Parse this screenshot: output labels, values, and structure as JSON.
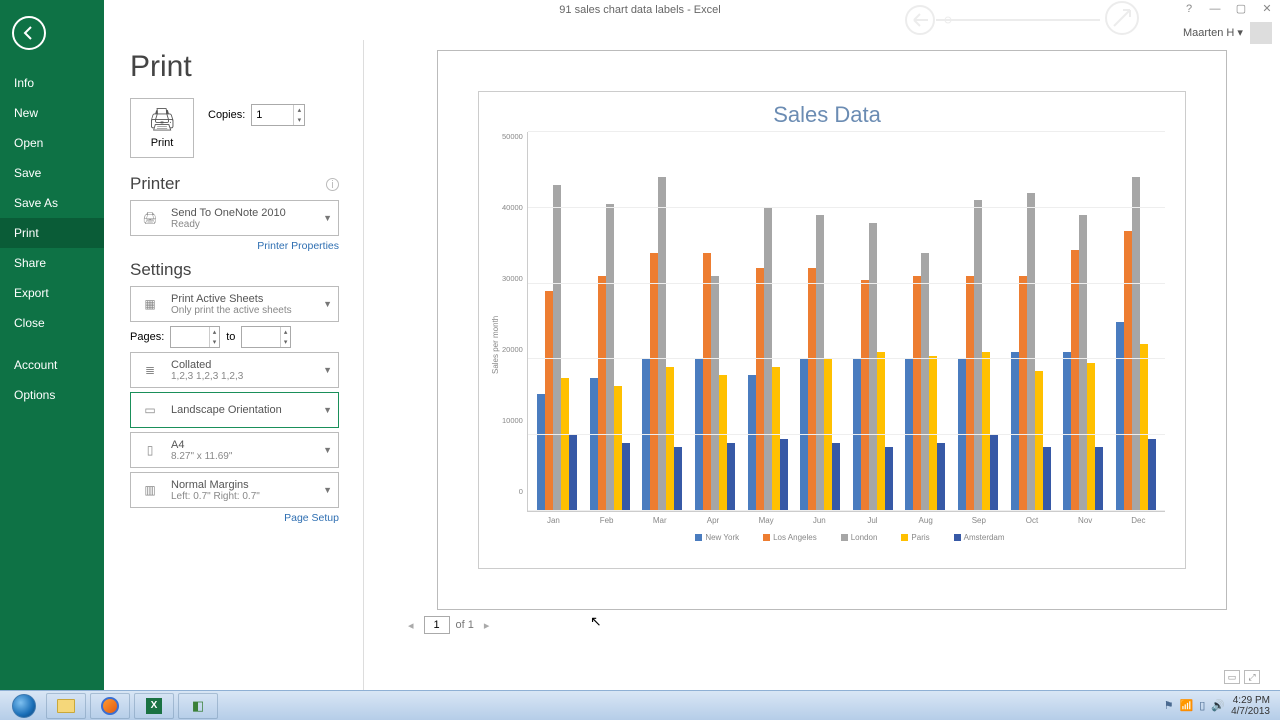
{
  "window": {
    "title": "91 sales chart data labels - Excel",
    "user": "Maarten H"
  },
  "sidebar": {
    "items": [
      {
        "label": "Info"
      },
      {
        "label": "New"
      },
      {
        "label": "Open"
      },
      {
        "label": "Save"
      },
      {
        "label": "Save As"
      },
      {
        "label": "Print",
        "active": true
      },
      {
        "label": "Share"
      },
      {
        "label": "Export"
      },
      {
        "label": "Close"
      }
    ],
    "secondary": [
      {
        "label": "Account"
      },
      {
        "label": "Options"
      }
    ]
  },
  "page": {
    "title": "Print",
    "print_button": "Print",
    "copies_label": "Copies:",
    "copies_value": "1"
  },
  "printer": {
    "heading": "Printer",
    "name": "Send To OneNote 2010",
    "status": "Ready",
    "properties_link": "Printer Properties"
  },
  "settings": {
    "heading": "Settings",
    "active_sheets": {
      "line1": "Print Active Sheets",
      "line2": "Only print the active sheets"
    },
    "pages_label": "Pages:",
    "pages_to": "to",
    "collated": {
      "line1": "Collated",
      "line2": "1,2,3    1,2,3    1,2,3"
    },
    "orientation": {
      "line1": "Landscape Orientation"
    },
    "paper": {
      "line1": "A4",
      "line2": "8.27\" x 11.69\""
    },
    "margins": {
      "line1": "Normal Margins",
      "line2": "Left:  0.7\"     Right:  0.7\""
    },
    "page_setup_link": "Page Setup"
  },
  "nav": {
    "page": "1",
    "of": "of 1"
  },
  "taskbar": {
    "time": "4:29 PM",
    "date": "4/7/2013"
  },
  "chart_data": {
    "type": "bar",
    "title": "Sales Data",
    "ylabel": "Sales per month",
    "ylim": [
      0,
      50000
    ],
    "yticks": [
      0,
      10000,
      20000,
      30000,
      40000,
      50000
    ],
    "categories": [
      "Jan",
      "Feb",
      "Mar",
      "Apr",
      "May",
      "Jun",
      "Jul",
      "Aug",
      "Sep",
      "Oct",
      "Nov",
      "Dec"
    ],
    "series": [
      {
        "name": "New York",
        "color": "#4a7cbf",
        "values": [
          15500,
          17500,
          20000,
          20000,
          18000,
          20000,
          20000,
          20000,
          20000,
          21000,
          21000,
          25000
        ]
      },
      {
        "name": "Los Angeles",
        "color": "#ed7d31",
        "values": [
          29000,
          31000,
          34000,
          34000,
          32000,
          32000,
          30500,
          31000,
          31000,
          31000,
          34500,
          37000
        ]
      },
      {
        "name": "London",
        "color": "#a6a6a6",
        "values": [
          43000,
          40500,
          44000,
          31000,
          40000,
          39000,
          38000,
          34000,
          41000,
          42000,
          39000,
          44000
        ]
      },
      {
        "name": "Paris",
        "color": "#ffc000",
        "values": [
          17500,
          16500,
          19000,
          18000,
          19000,
          20000,
          21000,
          20500,
          21000,
          18500,
          19500,
          22000
        ]
      },
      {
        "name": "Amsterdam",
        "color": "#3759a6",
        "values": [
          10000,
          9000,
          8500,
          9000,
          9500,
          9000,
          8500,
          9000,
          10000,
          8500,
          8500,
          9500
        ]
      }
    ],
    "legend": [
      "New York",
      "Los Angeles",
      "London",
      "Paris",
      "Amsterdam"
    ]
  }
}
